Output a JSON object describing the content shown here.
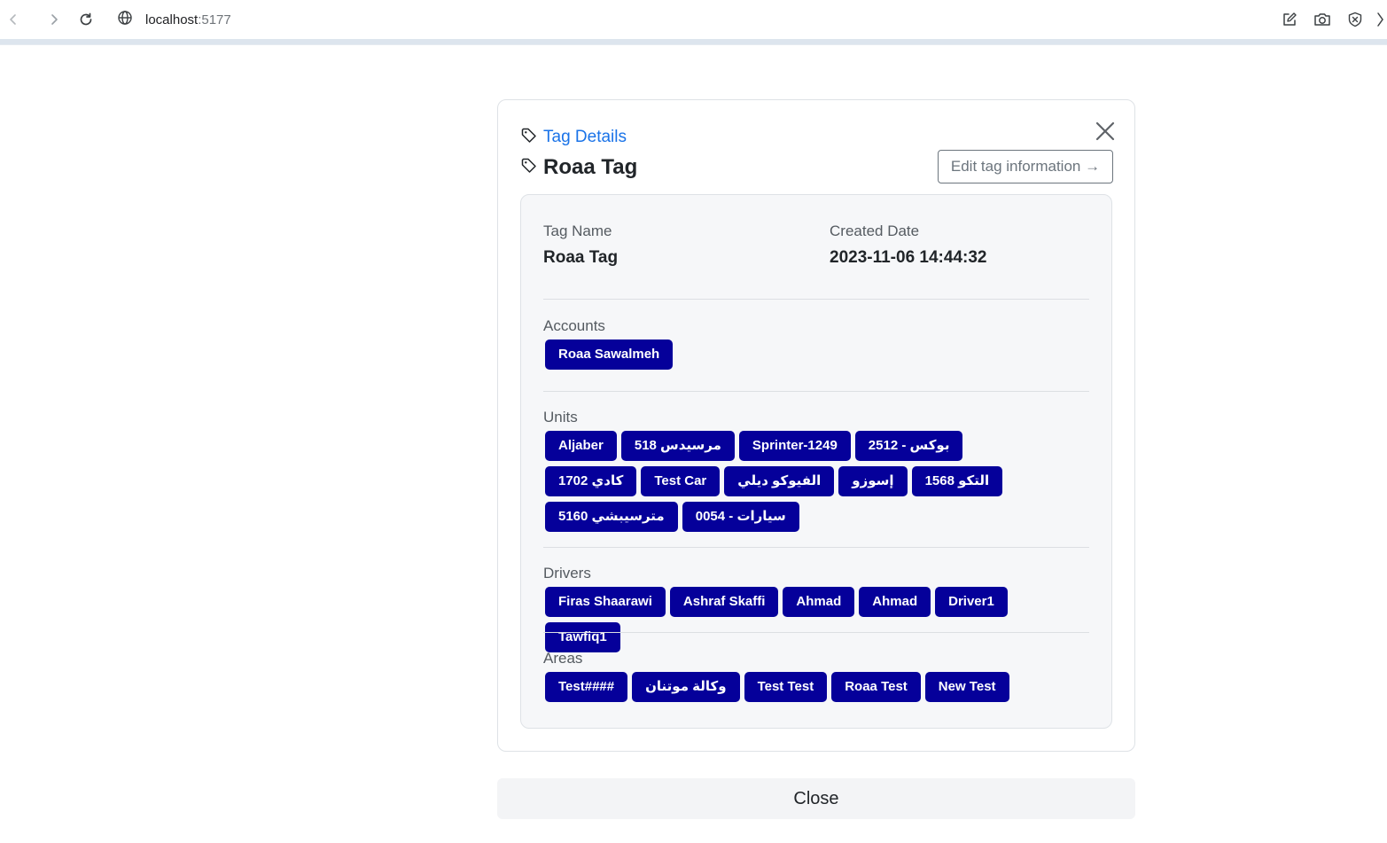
{
  "browser": {
    "url_host": "localhost",
    "url_port": ":5177",
    "icons": {
      "back": "back-arrow-icon",
      "forward": "forward-arrow-icon",
      "reload": "reload-icon",
      "site": "globe-icon",
      "edit": "edit-page-icon",
      "screenshot": "camera-icon",
      "shield": "shield-x-icon"
    }
  },
  "modal": {
    "breadcrumb": "Tag Details",
    "title": "Roaa Tag",
    "edit_button": "Edit tag information →",
    "close_icon": "close-icon",
    "tag_icon": "tag-icon"
  },
  "details": {
    "tag_name_label": "Tag Name",
    "tag_name_value": "Roaa Tag",
    "created_label": "Created Date",
    "created_value": "2023-11-06 14:44:32"
  },
  "sections": {
    "accounts": {
      "label": "Accounts",
      "items": [
        "Roaa Sawalmeh"
      ]
    },
    "units": {
      "label": "Units",
      "items": [
        "Aljaber",
        "مرسيدس 518",
        "Sprinter-1249",
        "بوكس - 2512",
        "كادي 1702",
        "Test Car",
        "الفيوكو ديلي",
        "إسوزو",
        "التكو 1568",
        "مترسيبشي 5160",
        "سيارات - 0054"
      ]
    },
    "drivers": {
      "label": "Drivers",
      "items": [
        "Firas Shaarawi",
        "Ashraf Skaffi",
        "Ahmad",
        "Ahmad",
        "Driver1",
        "Tawfiq1"
      ]
    },
    "areas": {
      "label": "Areas",
      "items": [
        "Test####",
        "وكالة موتنان",
        "Test Test",
        "Roaa Test",
        "New Test"
      ]
    }
  },
  "footer": {
    "close_label": "Close"
  },
  "colors": {
    "chip_background": "#05009a",
    "breadcrumb_link": "#1a73e8"
  }
}
